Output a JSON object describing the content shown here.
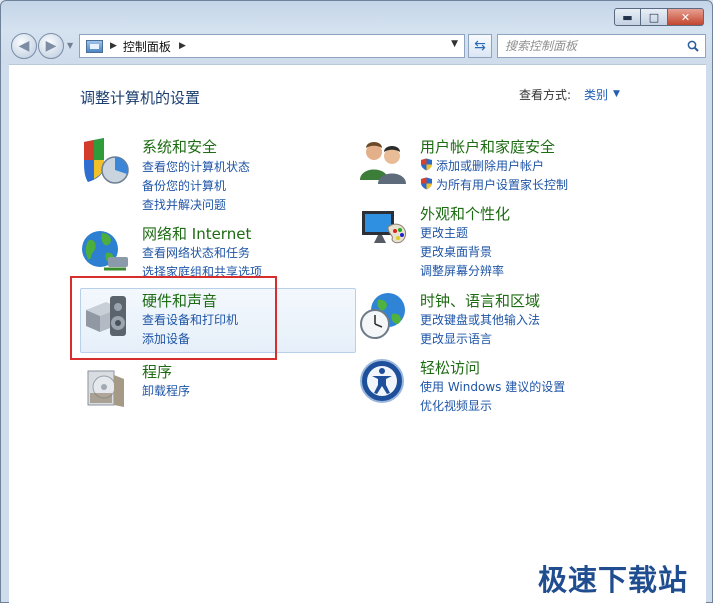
{
  "window": {
    "caption_buttons": {
      "minimize": "▬",
      "maximize": "□",
      "close": "✕"
    }
  },
  "navbar": {
    "back_icon": "back-arrow-icon",
    "forward_icon": "forward-arrow-icon",
    "address": {
      "location": "控制面板",
      "separator": "▶",
      "dropdown": "▼"
    },
    "refresh_icon": "refresh-icon",
    "search": {
      "placeholder": "搜索控制面板",
      "icon": "magnifier-icon"
    }
  },
  "main": {
    "heading": "调整计算机的设置",
    "view_by": {
      "label": "查看方式:",
      "value": "类别",
      "arrow": "▼"
    },
    "categories": [
      {
        "title": "系统和安全",
        "links": [
          "查看您的计算机状态",
          "备份您的计算机",
          "查找并解决问题"
        ],
        "icon": "shield-pie-icon"
      },
      {
        "title": "网络和 Internet",
        "links": [
          "查看网络状态和任务",
          "选择家庭组和共享选项"
        ],
        "icon": "globe-network-icon"
      },
      {
        "title": "硬件和声音",
        "links": [
          "查看设备和打印机",
          "添加设备"
        ],
        "icon": "printer-speaker-icon"
      },
      {
        "title": "程序",
        "links": [
          "卸载程序"
        ],
        "icon": "programs-box-icon"
      },
      {
        "title": "用户帐户和家庭安全",
        "links": [
          "添加或删除用户帐户",
          "为所有用户设置家长控制"
        ],
        "icon": "users-icon"
      },
      {
        "title": "外观和个性化",
        "links": [
          "更改主题",
          "更改桌面背景",
          "调整屏幕分辨率"
        ],
        "icon": "monitor-palette-icon"
      },
      {
        "title": "时钟、语言和区域",
        "links": [
          "更改键盘或其他输入法",
          "更改显示语言"
        ],
        "icon": "clock-globe-icon"
      },
      {
        "title": "轻松访问",
        "links": [
          "使用 Windows 建议的设置",
          "优化视频显示"
        ],
        "icon": "ease-of-access-icon"
      }
    ]
  },
  "watermark": "极速下载站",
  "colors": {
    "title_green": "#1d6b12",
    "link_blue": "#1f55a6",
    "highlight_red": "#d62d2d"
  }
}
